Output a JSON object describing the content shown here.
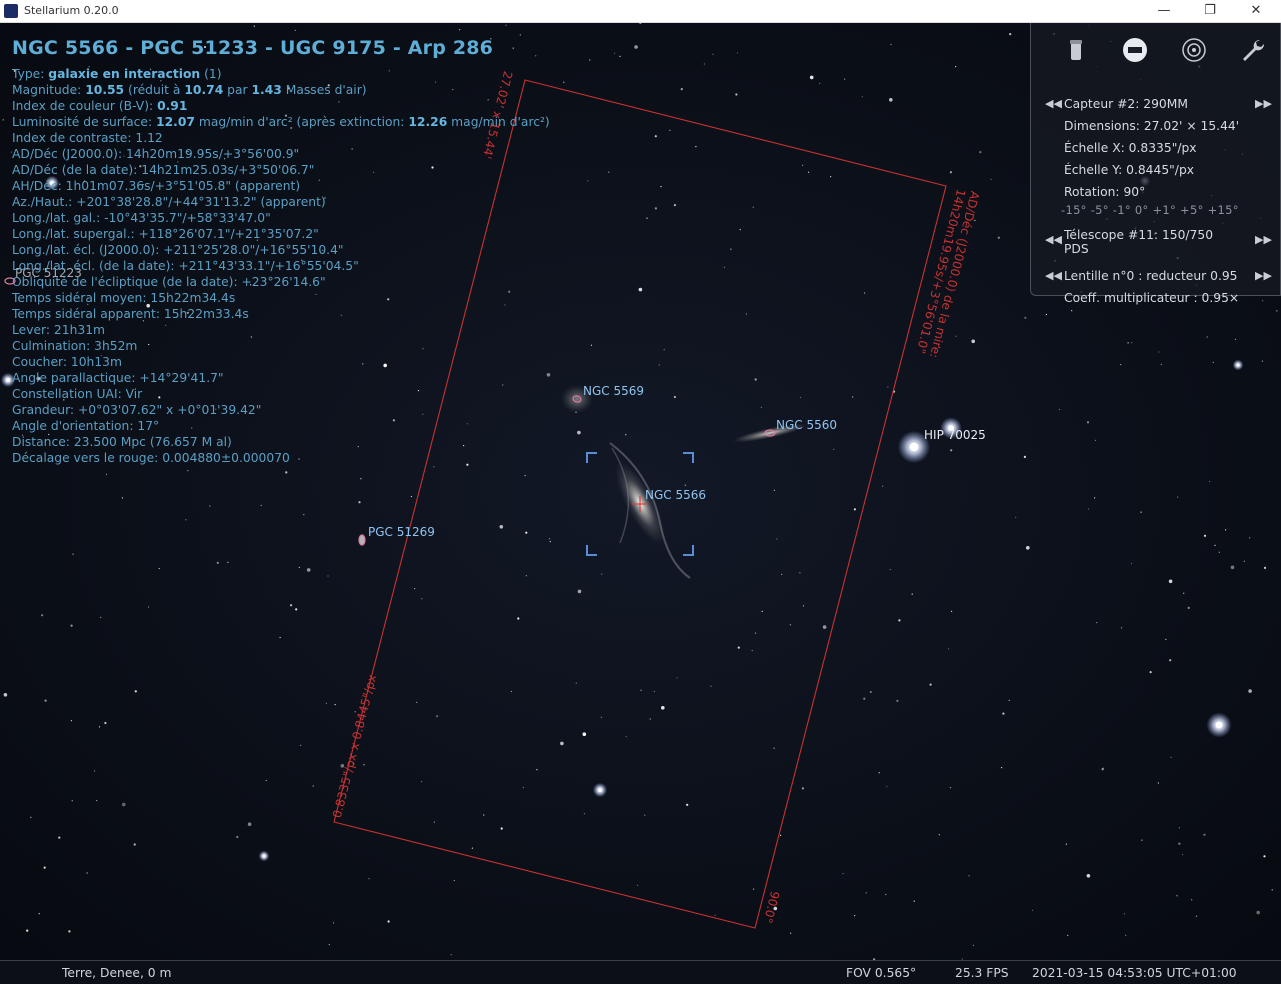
{
  "window": {
    "title": "Stellarium 0.20.0",
    "minimize": "—",
    "maximize": "❐",
    "close": "✕"
  },
  "info": {
    "title": "NGC 5566 - PGC 51233 - UGC 9175 - Arp 286",
    "type_label": "Type: ",
    "type_value": "galaxie en interaction",
    "type_suffix": " (1)",
    "mag_label": "Magnitude: ",
    "mag_value": "10.55",
    "mag_mid": " (réduit à ",
    "mag_red": "10.74",
    "mag_par": " par ",
    "mag_air": "1.43",
    "mag_end": " Masses d'air)",
    "ci_label": "Index de couleur (B-V): ",
    "ci_value": "0.91",
    "sb_label": "Luminosité de surface: ",
    "sb_value": "12.07",
    "sb_mid": " mag/min d'arc² (après extinction: ",
    "sb_ext": "12.26",
    "sb_end": " mag/min d'arc²)",
    "lines": [
      "Index de contraste: 1.12",
      "AD/Déc (J2000.0): 14h20m19.95s/+3°56'00.9\"",
      "AD/Déc (de la date): 14h21m25.03s/+3°50'06.7\"",
      "AH/Déc: 1h01m07.36s/+3°51'05.8\" (apparent)",
      "Az./Haut.: +201°38'28.8\"/+44°31'13.2\" (apparent)",
      "Long./lat. gal.: -10°43'35.7\"/+58°33'47.0\"",
      "Long./lat. supergal.: +118°26'07.1\"/+21°35'07.2\"",
      "Long./lat. écl. (J2000.0): +211°25'28.0\"/+16°55'10.4\"",
      "Long./lat. écl. (de la date): +211°43'33.1\"/+16°55'04.5\"",
      "Obliquité de l'écliptique (de la date): +23°26'14.6\"",
      "Temps sidéral moyen: 15h22m34.4s",
      "Temps sidéral apparent: 15h22m33.4s",
      "Lever: 21h31m",
      "Culmination: 3h52m",
      "Coucher: 10h13m",
      "Angle parallactique: +14°29'41.7\"",
      "Constellation UAI: Vir",
      "Grandeur: +0°03'07.62\" x +0°01'39.42\"",
      "Angle d'orientation: 17°",
      "Distance: 23.500 Mpc (76.657 M al)",
      "Décalage vers le rouge: 0.004880±0.000070"
    ],
    "overlap_label": "PGC 51223"
  },
  "sky_labels": {
    "ngc5569": "NGC 5569",
    "ngc5560": "NGC 5560",
    "ngc5566": "NGC 5566",
    "pgc51269": "PGC 51269",
    "hip70025": "HIP 70025"
  },
  "ccd_frame": {
    "top_edge": "27.02' x 15.44'",
    "right_edge": "AD/Déc (J2000.0) de la mire:",
    "right_edge2": "14h20m19.95s/+3°56'01.0\"",
    "left_edge": "0.8335\"/px x 0.8445\"/px",
    "bottom_edge": "90.0°"
  },
  "oculars": {
    "sensor": "Capteur #2: 290MM",
    "dimensions": "Dimensions: 27.02' × 15.44'",
    "scale_x": "Échelle X: 0.8335\"/px",
    "scale_y": "Échelle Y: 0.8445\"/px",
    "rotation": "Rotation: 90°",
    "rotation_steps": "-15° -5° -1° 0° +1° +5° +15°",
    "telescope": "Télescope #11: 150/750",
    "telescope2": "PDS",
    "lens": "Lentille n°0 : reducteur 0.95",
    "multiplier": "Coeff. multiplicateur : 0.95×",
    "arrow_left": "◀◀",
    "arrow_right": "▶▶"
  },
  "status": {
    "location": "Terre, Denee, 0 m",
    "fov": "FOV 0.565°",
    "fps": "25.3 FPS",
    "datetime": "2021-03-15 04:53:05 UTC+01:00"
  },
  "colors": {
    "frame": "#c83232",
    "info_text": "#5b9fc4",
    "label_blue": "#8fc4f0",
    "reticle": "#5b8cd8"
  }
}
